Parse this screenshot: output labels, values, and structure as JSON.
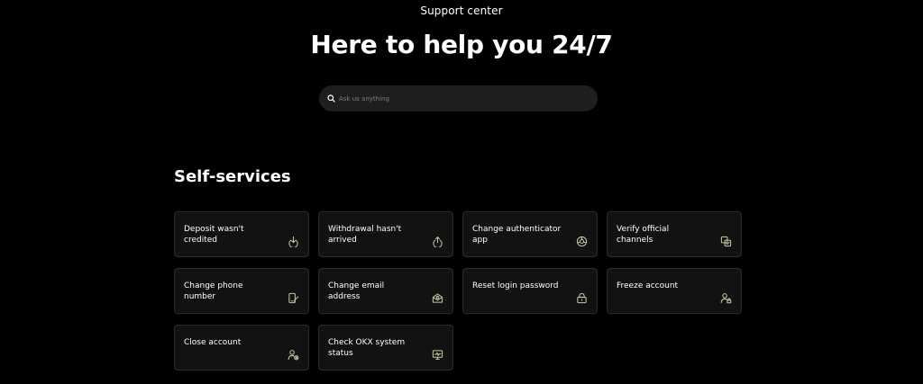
{
  "header": {
    "eyebrow": "Support center",
    "title": "Here to help you 24/7"
  },
  "search": {
    "placeholder": "Ask us anything",
    "value": "",
    "icon": "search-icon"
  },
  "self_services": {
    "title": "Self-services",
    "cards": [
      {
        "label": "Deposit wasn't credited",
        "icon": "deposit-icon"
      },
      {
        "label": "Withdrawal hasn't arrived",
        "icon": "withdrawal-icon"
      },
      {
        "label": "Change authenticator app",
        "icon": "authenticator-icon"
      },
      {
        "label": "Verify official channels",
        "icon": "verify-channels-icon"
      },
      {
        "label": "Change phone number",
        "icon": "phone-edit-icon"
      },
      {
        "label": "Change email address",
        "icon": "email-icon"
      },
      {
        "label": "Reset login password",
        "icon": "lock-icon"
      },
      {
        "label": "Freeze account",
        "icon": "user-freeze-icon"
      },
      {
        "label": "Close account",
        "icon": "user-close-icon"
      },
      {
        "label": "Check OKX system status",
        "icon": "system-status-icon"
      }
    ]
  },
  "colors": {
    "background": "#000000",
    "card_background": "#121212",
    "card_border": "#2c2c2c",
    "search_background": "#1e1e1e",
    "icon_stroke": "#c9c9a8"
  }
}
